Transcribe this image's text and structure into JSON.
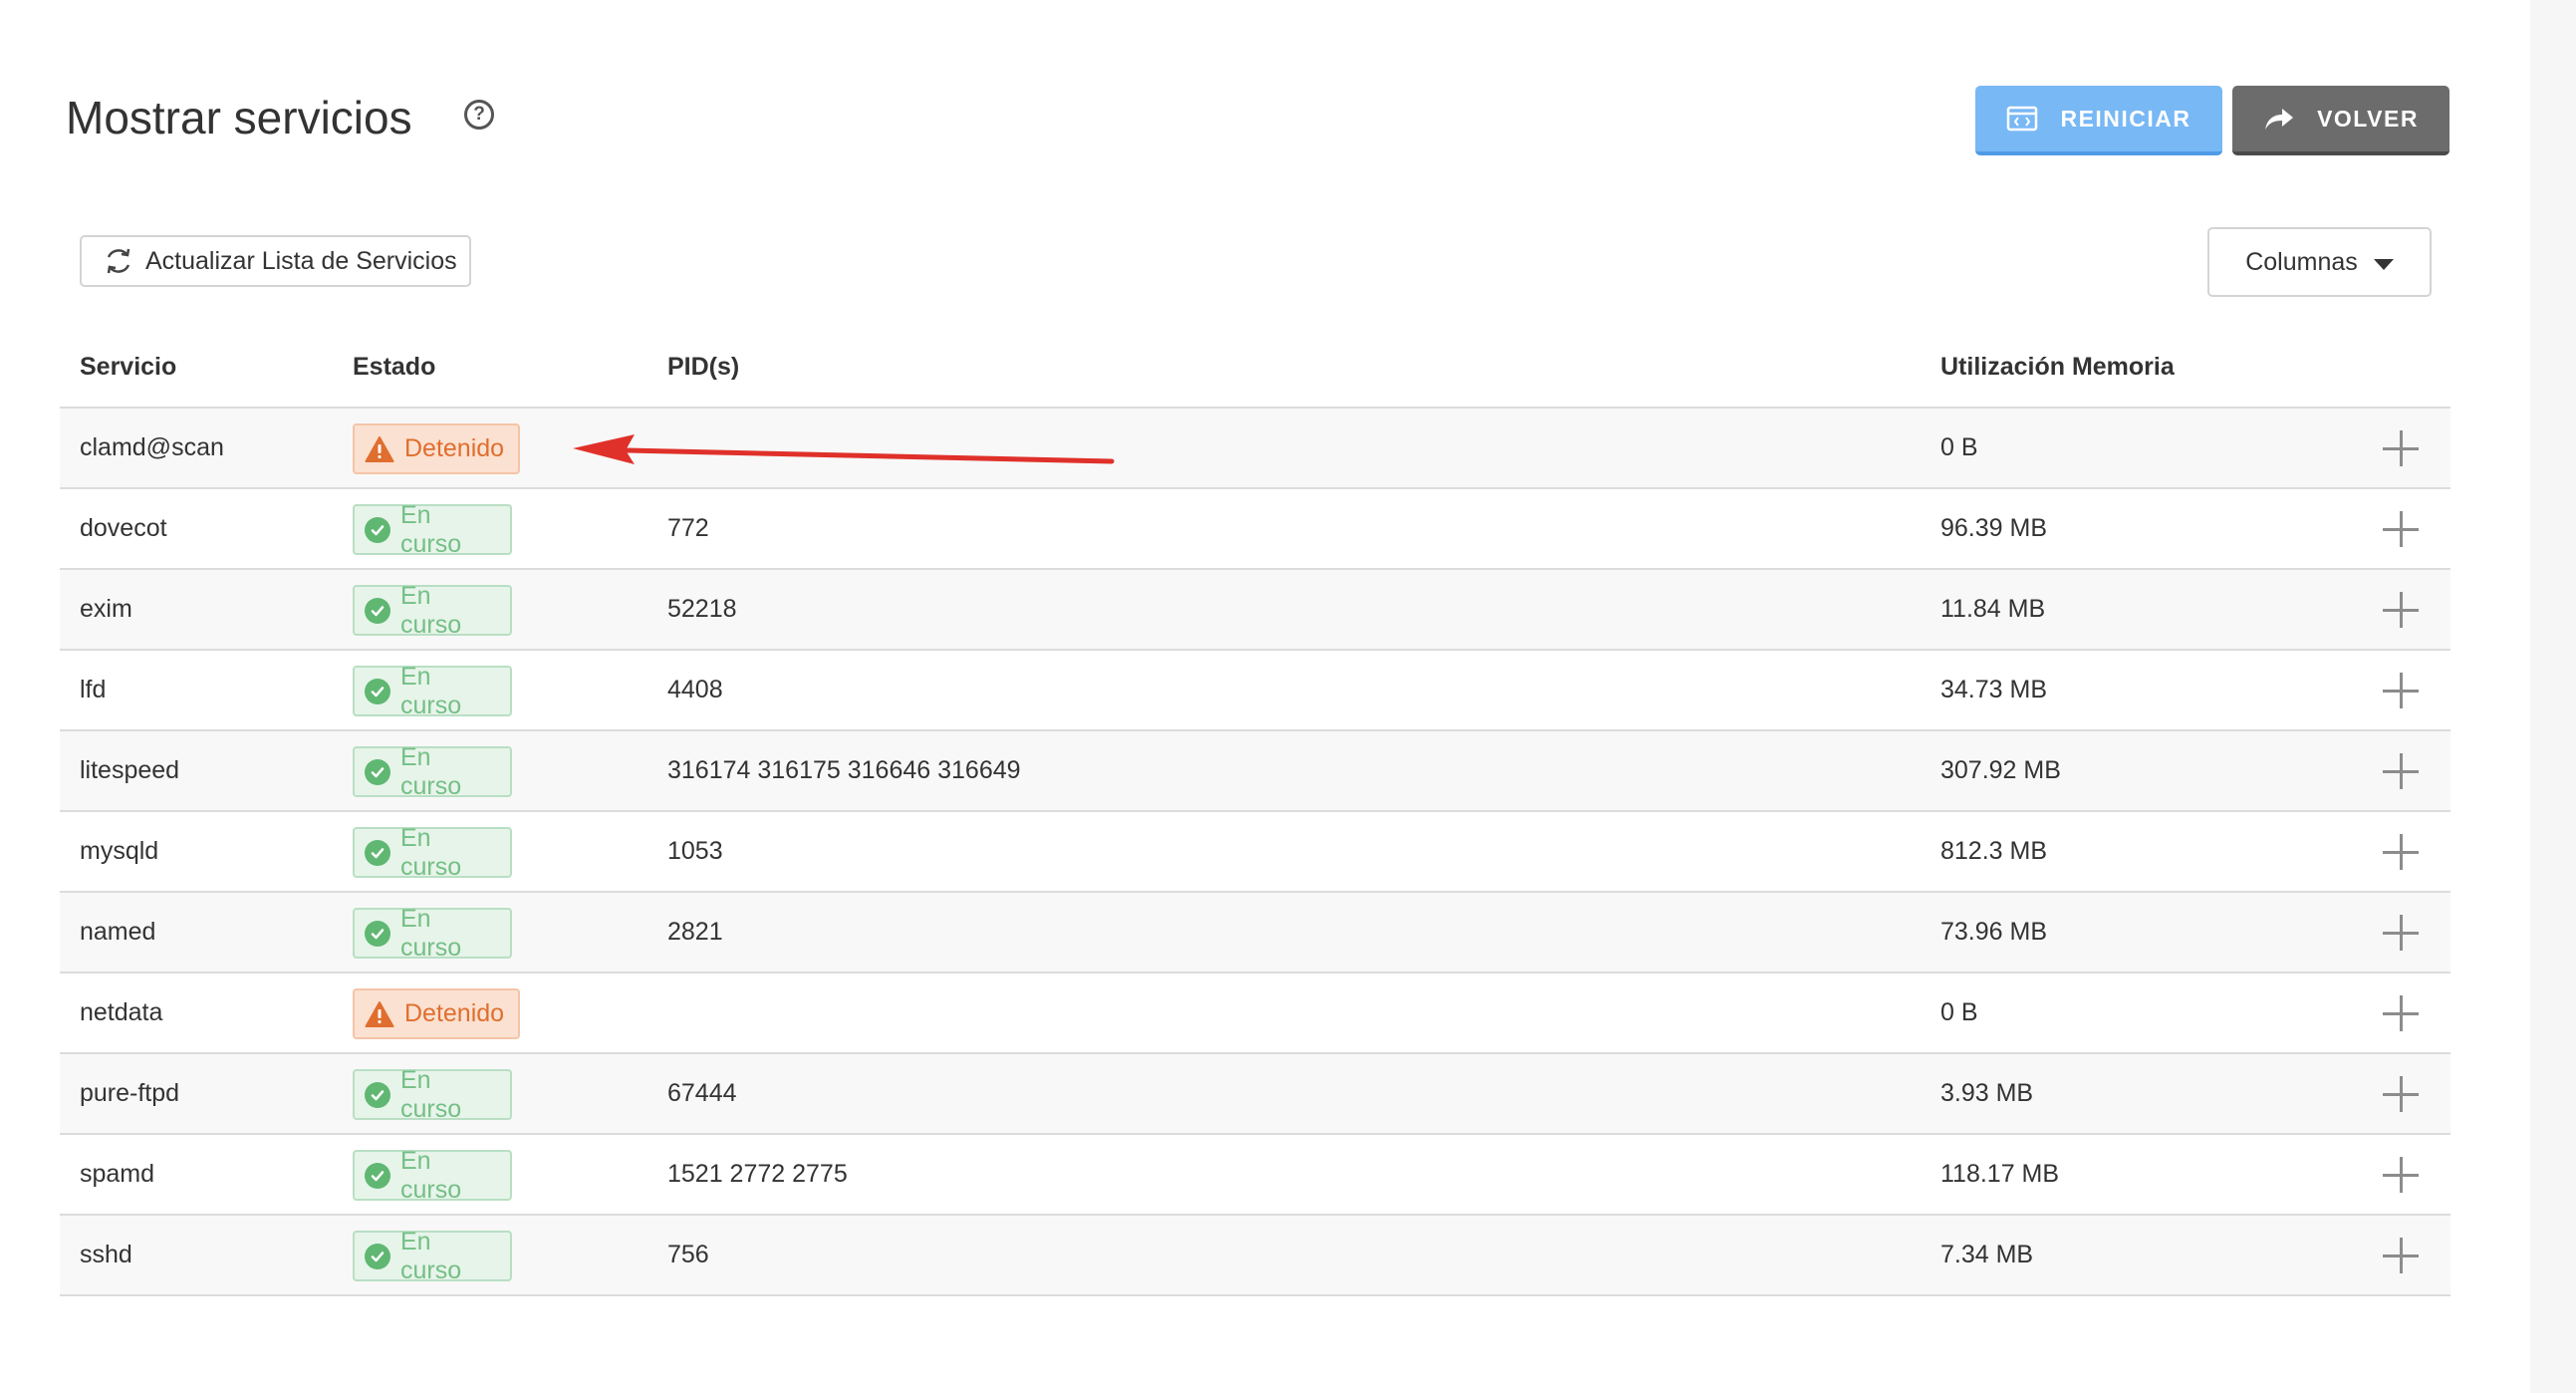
{
  "page": {
    "title": "Mostrar servicios",
    "help_icon": "question-circle-icon"
  },
  "header_actions": {
    "restart_label": "REINICIAR",
    "restart_icon": "code-window-icon",
    "back_label": "VOLVER",
    "back_icon": "share-arrow-icon"
  },
  "toolbar": {
    "refresh_label": "Actualizar Lista de Servicios",
    "refresh_icon": "refresh-icon",
    "columns_label": "Columnas"
  },
  "table": {
    "headers": {
      "service": "Servicio",
      "status": "Estado",
      "pids": "PID(s)",
      "memory": "Utilización Memoria"
    },
    "rows": [
      {
        "service": "clamd@scan",
        "status": "Detenido",
        "state": "stopped",
        "pids": "",
        "memory": "0 B"
      },
      {
        "service": "dovecot",
        "status": "En curso",
        "state": "running",
        "pids": "772",
        "memory": "96.39 MB"
      },
      {
        "service": "exim",
        "status": "En curso",
        "state": "running",
        "pids": "52218",
        "memory": "11.84 MB"
      },
      {
        "service": "lfd",
        "status": "En curso",
        "state": "running",
        "pids": "4408",
        "memory": "34.73 MB"
      },
      {
        "service": "litespeed",
        "status": "En curso",
        "state": "running",
        "pids": "316174 316175 316646 316649",
        "memory": "307.92 MB"
      },
      {
        "service": "mysqld",
        "status": "En curso",
        "state": "running",
        "pids": "1053",
        "memory": "812.3 MB"
      },
      {
        "service": "named",
        "status": "En curso",
        "state": "running",
        "pids": "2821",
        "memory": "73.96 MB"
      },
      {
        "service": "netdata",
        "status": "Detenido",
        "state": "stopped",
        "pids": "",
        "memory": "0 B"
      },
      {
        "service": "pure-ftpd",
        "status": "En curso",
        "state": "running",
        "pids": "67444",
        "memory": "3.93 MB"
      },
      {
        "service": "spamd",
        "status": "En curso",
        "state": "running",
        "pids": "1521 2772 2775",
        "memory": "118.17 MB"
      },
      {
        "service": "sshd",
        "status": "En curso",
        "state": "running",
        "pids": "756",
        "memory": "7.34 MB"
      }
    ]
  },
  "colors": {
    "restart_button": "#78b8f5",
    "back_button": "#6c6c6c",
    "running_badge": "#e7f4ea",
    "running_text": "#74bf85",
    "stopped_badge": "#fbe1d1",
    "stopped_text": "#e06e2e",
    "annotation_arrow": "#e0302a"
  },
  "annotation": {
    "type": "arrow",
    "points_to": "clamd@scan status badge"
  }
}
